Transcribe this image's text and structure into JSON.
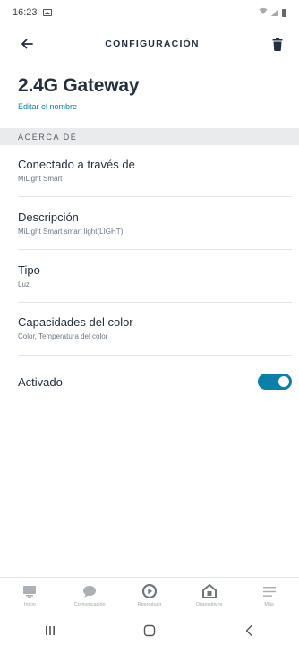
{
  "status_bar": {
    "time": "16:23"
  },
  "header": {
    "title": "CONFIGURACIÓN"
  },
  "device": {
    "name": "2.4G Gateway",
    "edit_link": "Editar el nombre"
  },
  "section": {
    "title": "ACERCA DE"
  },
  "rows": [
    {
      "label": "Conectado a través de",
      "value": "MiLight Smart"
    },
    {
      "label": "Descripción",
      "value": "MiLight Smart smart light(LIGHT)"
    },
    {
      "label": "Tipo",
      "value": "Luz"
    },
    {
      "label": "Capacidades del color",
      "value": "Color, Temperatura del color"
    }
  ],
  "toggle": {
    "label": "Activado",
    "enabled": true
  },
  "bottom_nav": {
    "items": [
      {
        "label": "Inicio",
        "icon": "home-icon"
      },
      {
        "label": "Comunicación",
        "icon": "chat-icon"
      },
      {
        "label": "Reproducir",
        "icon": "play-icon"
      },
      {
        "label": "Dispositivos",
        "icon": "devices-icon"
      },
      {
        "label": "Más",
        "icon": "menu-icon"
      }
    ]
  },
  "colors": {
    "accent": "#0a7fa8",
    "text": "#232f3e",
    "section_bg": "#e9ebed"
  }
}
